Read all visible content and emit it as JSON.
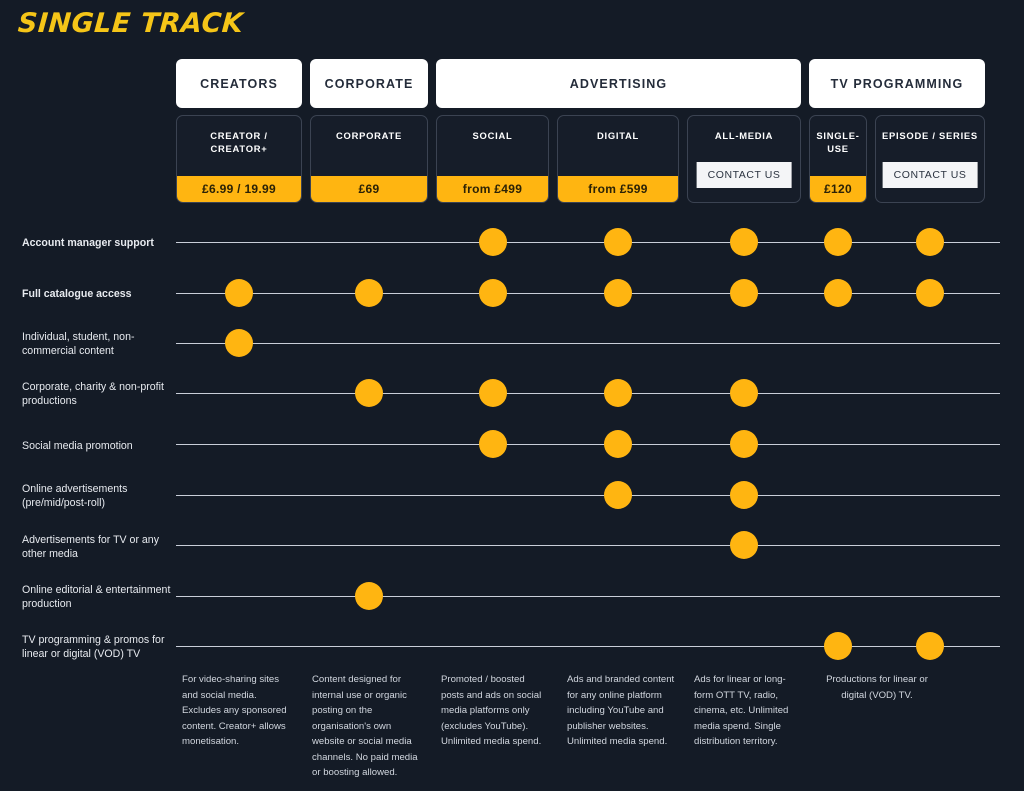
{
  "brand": {
    "name": "SINGLE TRACK"
  },
  "colors": {
    "background": "#141b26",
    "accent": "#ffb511",
    "tab_background": "#ffffff",
    "card_border": "#3b4352",
    "row_line": "#c9ced8",
    "text": "#ffffff"
  },
  "groups": [
    {
      "label": "CREATORS",
      "span": 1
    },
    {
      "label": "CORPORATE",
      "span": 1
    },
    {
      "label": "ADVERTISING",
      "span": 3
    },
    {
      "label": "TV PROGRAMMING",
      "span": 2
    }
  ],
  "plans": [
    {
      "name": "CREATOR / CREATOR+",
      "price": "£6.99 / 19.99",
      "cta": null
    },
    {
      "name": "CORPORATE",
      "price": "£69",
      "cta": null
    },
    {
      "name": "SOCIAL",
      "price": "from £499",
      "cta": null
    },
    {
      "name": "DIGITAL",
      "price": "from £599",
      "cta": null
    },
    {
      "name": "ALL-MEDIA",
      "price": null,
      "cta": "CONTACT US"
    },
    {
      "name": "SINGLE-USE",
      "price": "£120",
      "cta": null
    },
    {
      "name": "EPISODE / SERIES",
      "price": null,
      "cta": "CONTACT US"
    }
  ],
  "features": [
    {
      "label": "Account manager support",
      "bold": true,
      "included": [
        false,
        false,
        true,
        true,
        true,
        true,
        true
      ]
    },
    {
      "label": "Full catalogue access",
      "bold": true,
      "included": [
        true,
        true,
        true,
        true,
        true,
        true,
        true
      ]
    },
    {
      "label": "Individual, student, non-commercial content",
      "bold": false,
      "included": [
        true,
        false,
        false,
        false,
        false,
        false,
        false
      ]
    },
    {
      "label": "Corporate, charity & non-profit productions",
      "bold": false,
      "included": [
        false,
        true,
        true,
        true,
        true,
        false,
        false
      ]
    },
    {
      "label": "Social media promotion",
      "bold": false,
      "included": [
        false,
        false,
        true,
        true,
        true,
        false,
        false
      ]
    },
    {
      "label": "Online advertisements (pre/mid/post-roll)",
      "bold": false,
      "included": [
        false,
        false,
        false,
        true,
        true,
        false,
        false
      ]
    },
    {
      "label": "Advertisements for TV or any other media",
      "bold": false,
      "included": [
        false,
        false,
        false,
        false,
        true,
        false,
        false
      ]
    },
    {
      "label": "Online editorial & entertainment production",
      "bold": false,
      "included": [
        false,
        true,
        false,
        false,
        false,
        false,
        false
      ]
    },
    {
      "label": "TV programming & promos for linear or digital (VOD) TV",
      "bold": false,
      "included": [
        false,
        false,
        false,
        false,
        false,
        true,
        true
      ]
    }
  ],
  "footnotes": [
    "For video-sharing sites and social media. Excludes any sponsored content. Creator+ allows monetisation.",
    "Content designed for internal use or organic posting on the organisation's own website or social media channels. No paid media or boosting allowed.",
    "Promoted / boosted posts and ads on social media platforms only (excludes YouTube). Unlimited media spend.",
    "Ads and branded content for any online platform including YouTube and publisher websites. Unlimited media spend.",
    "Ads for linear or long-form OTT TV, radio, cinema, etc. Unlimited media spend. Single distribution territory.",
    "Productions for linear or digital (VOD) TV."
  ]
}
